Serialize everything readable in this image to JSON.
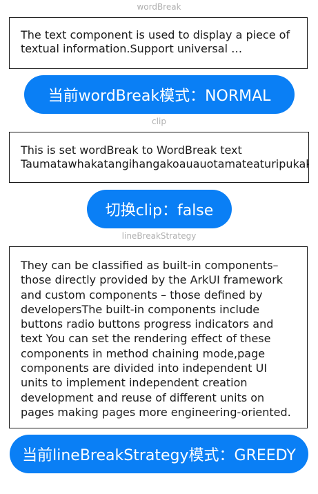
{
  "sections": {
    "wordbreak": {
      "title": "wordBreak",
      "text_line1": "The text component is used to display a piece of",
      "text_line2": "textual information.Support universal …",
      "button_label": "当前wordBreak模式：NORMAL"
    },
    "clip": {
      "title": "clip",
      "text_line1": "This is set wordBreak to WordBreak text",
      "text_line2": "Taumatawhakatangihangakoauauotamateaturipukakapikimaungahoronukupokaiwhenuakitanatahu.",
      "button_label": "切换clip：false"
    },
    "linebreak": {
      "title": "lineBreakStrategy",
      "lines": [
        "They can be classified as built-in components–",
        "those directly provided by the ArkUI framework",
        "and custom components – those defined by",
        "developersThe built-in components include",
        "buttons radio buttons progress indicators and",
        "text You can set the rendering effect of these",
        "components in method chaining mode,page",
        "components are divided into independent UI",
        "units to implement independent creation",
        "development and reuse of different units on",
        "pages making pages more engineering-oriented."
      ],
      "button_label": "当前lineBreakStrategy模式：GREEDY"
    }
  },
  "colors": {
    "accent": "#0a7ff5",
    "border": "#1a1a1a",
    "section_title": "#b0b0b0"
  }
}
